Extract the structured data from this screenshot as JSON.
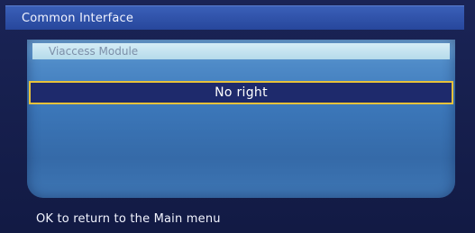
{
  "window": {
    "title": "Common Interface"
  },
  "panel": {
    "module_title": "Viaccess Module",
    "message": "No right"
  },
  "footer": {
    "hint": "OK to return to the Main menu"
  },
  "colors": {
    "title_bar": "#3158ad",
    "highlight_border": "#e8c23a",
    "highlight_fill": "#1e2a6c",
    "panel": "#3b76b8",
    "module_bar": "#c7e4f0"
  }
}
